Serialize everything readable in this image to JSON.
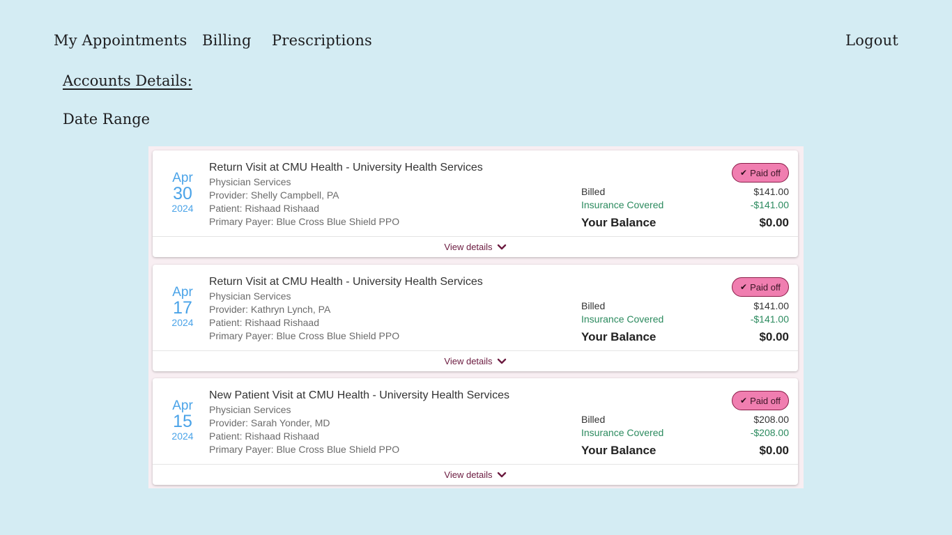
{
  "nav": {
    "appointments": "My Appointments",
    "billing": "Billing",
    "prescriptions": "Prescriptions",
    "logout": "Logout"
  },
  "page": {
    "title": "Accounts Details:",
    "date_range": "Date Range"
  },
  "visits": [
    {
      "month": "Apr",
      "day": "30",
      "year": "2024",
      "title": "Return Visit at CMU Health - University Health Services",
      "service": "Physician Services",
      "provider": "Provider: Shelly Campbell, PA",
      "patient": "Patient: Rishaad Rishaad",
      "payer": "Primary Payer: Blue Cross Blue Shield PPO",
      "status": "Paid off",
      "billed_label": "Billed",
      "billed": "$141.00",
      "insurance_label": "Insurance Covered",
      "insurance": "-$141.00",
      "balance_label": "Your Balance",
      "balance": "$0.00",
      "details_label": "View details"
    },
    {
      "month": "Apr",
      "day": "17",
      "year": "2024",
      "title": "Return Visit at CMU Health - University Health Services",
      "service": "Physician Services",
      "provider": "Provider: Kathryn Lynch, PA",
      "patient": "Patient: Rishaad Rishaad",
      "payer": "Primary Payer: Blue Cross Blue Shield PPO",
      "status": "Paid off",
      "billed_label": "Billed",
      "billed": "$141.00",
      "insurance_label": "Insurance Covered",
      "insurance": "-$141.00",
      "balance_label": "Your Balance",
      "balance": "$0.00",
      "details_label": "View details"
    },
    {
      "month": "Apr",
      "day": "15",
      "year": "2024",
      "title": "New Patient Visit at CMU Health - University Health Services",
      "service": "Physician Services",
      "provider": "Provider: Sarah Yonder, MD",
      "patient": "Patient: Rishaad Rishaad",
      "payer": "Primary Payer: Blue Cross Blue Shield PPO",
      "status": "Paid off",
      "billed_label": "Billed",
      "billed": "$208.00",
      "insurance_label": "Insurance Covered",
      "insurance": "-$208.00",
      "balance_label": "Your Balance",
      "balance": "$0.00",
      "details_label": "View details"
    }
  ],
  "colors": {
    "background": "#d4ecf3",
    "date_accent": "#4aa3e8",
    "paid_badge": "#f07eb0",
    "insurance_green": "#2b8a5e",
    "details_link": "#6b1a3f"
  },
  "icons": {
    "paid": "check-icon",
    "details": "chevron-down-icon"
  }
}
